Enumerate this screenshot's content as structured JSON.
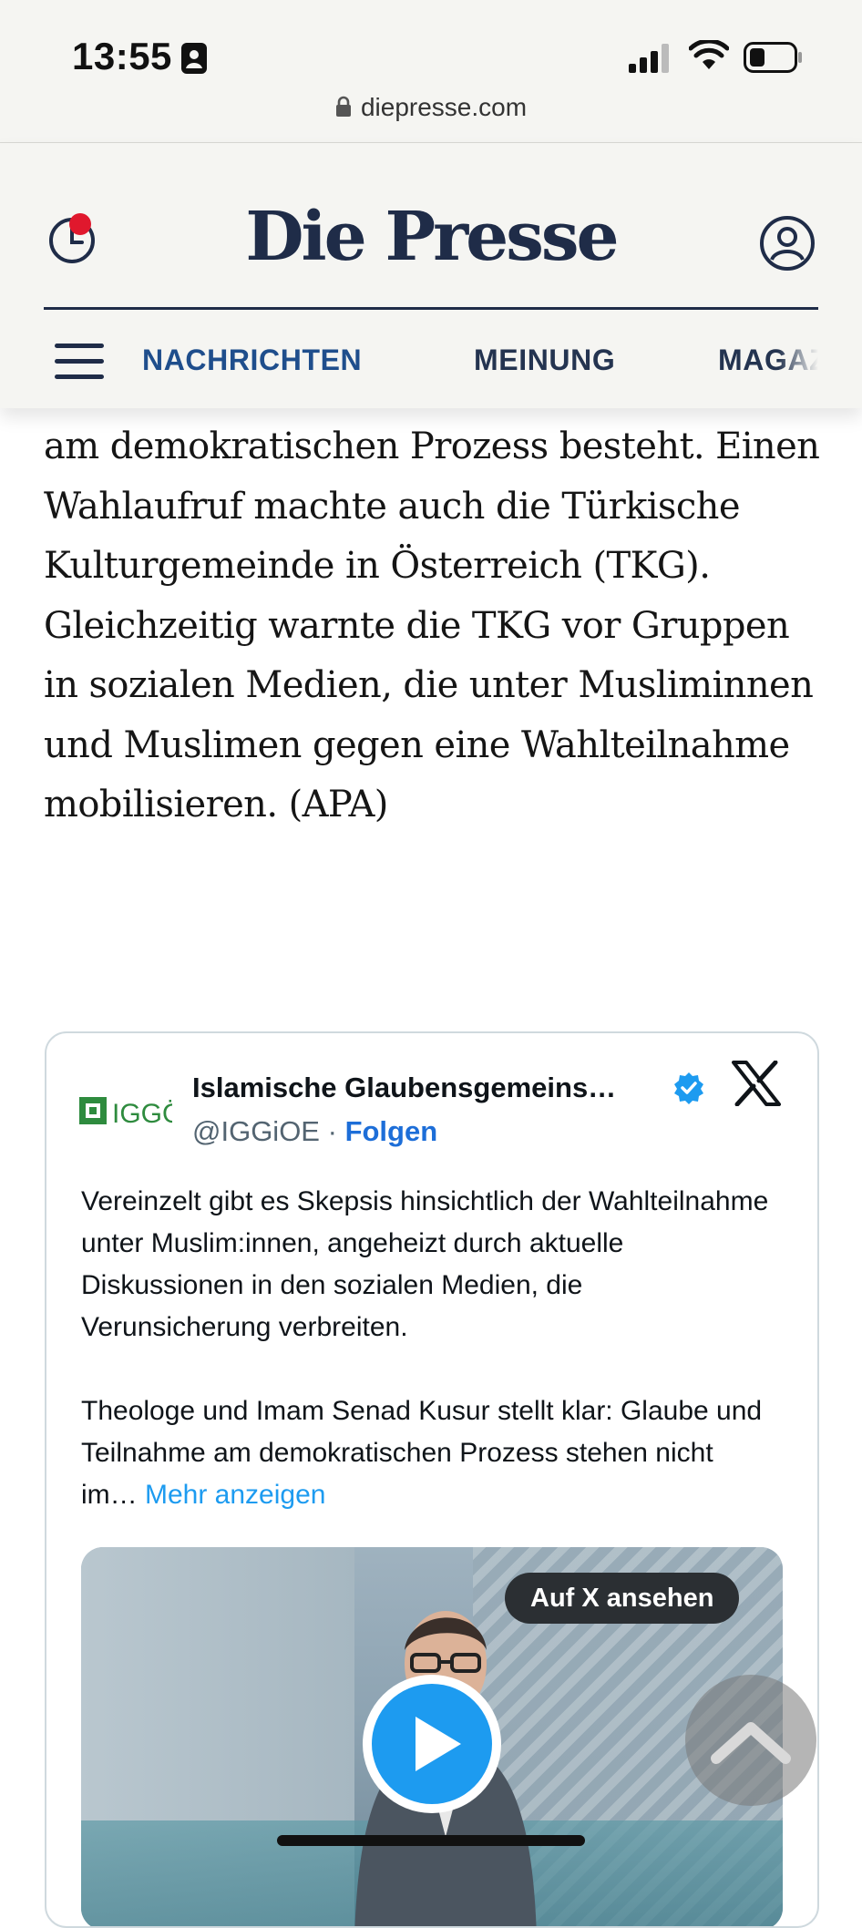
{
  "status_bar": {
    "time": "13:55",
    "url": "diepresse.com"
  },
  "header": {
    "logo": "Die Presse",
    "nav": {
      "news": "NACHRICHTEN",
      "opinion": "MEINUNG",
      "magazin": "MAGAZIN"
    },
    "brand_color": "#1f2c48",
    "notification_color": "#e0182d"
  },
  "article": {
    "paragraph": "am demokratischen Prozess besteht. Einen Wahlaufruf machte auch die Türkische Kulturgemeinde in Österreich (TKG). Gleichzeitig warnte die TKG vor Gruppen in sozialen Medien, die unter Musliminnen und Muslimen gegen eine Wahlteilnahme mobilisieren. (APA)"
  },
  "tweet": {
    "avatar_text": "IGGÖ",
    "author": "Islamische Glaubensgemeins…",
    "handle": "@IGGiOE",
    "separator": "·",
    "follow": "Folgen",
    "text_1": "Vereinzelt gibt es Skepsis hinsichtlich der Wahlteilnahme unter Muslim:innen, angeheizt durch aktuelle Diskussionen in den sozialen Medien, die Verunsicherung verbreiten.",
    "text_2": "Theologe und Imam Senad Kusur stellt klar: Glaube und Teilnahme am demokratischen Prozess stehen nicht im…",
    "more": "Mehr anzeigen",
    "view_on_x": "Auf X ansehen",
    "link_color": "#1d9bf0"
  }
}
